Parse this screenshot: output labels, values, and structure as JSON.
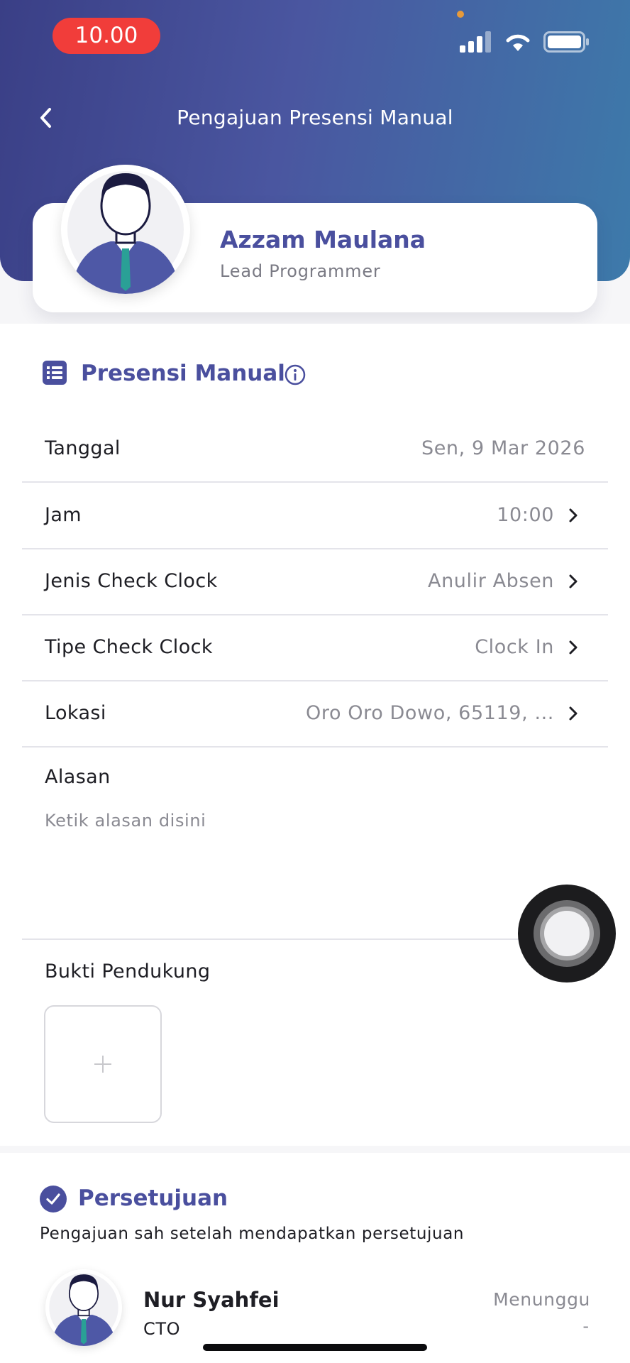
{
  "status_bar": {
    "time": "10.00"
  },
  "header": {
    "title": "Pengajuan Presensi Manual"
  },
  "profile": {
    "name": "Azzam Maulana",
    "role": "Lead Programmer"
  },
  "section": {
    "title": "Presensi Manual"
  },
  "form": {
    "rows": [
      {
        "label": "Tanggal",
        "value": "Sen, 9 Mar 2026",
        "chevron": false
      },
      {
        "label": "Jam",
        "value": "10:00",
        "chevron": true
      },
      {
        "label": "Jenis Check Clock",
        "value": "Anulir Absen",
        "chevron": true
      },
      {
        "label": "Tipe Check Clock",
        "value": "Clock In",
        "chevron": true
      },
      {
        "label": "Lokasi",
        "value": "Oro Oro Dowo, 65119, ...",
        "chevron": true
      }
    ],
    "reason": {
      "label": "Alasan",
      "placeholder": "Ketik alasan disini",
      "value": ""
    },
    "proof": {
      "label": "Bukti Pendukung"
    }
  },
  "approval": {
    "title": "Persetujuan",
    "subtitle": "Pengajuan sah setelah mendapatkan persetujuan",
    "approvers": [
      {
        "name": "Nur Syahfei",
        "role": "CTO",
        "status": "Menunggu",
        "date": "-"
      }
    ]
  },
  "colors": {
    "accent": "#4a4f9e",
    "header_start": "#3a3f86",
    "header_end": "#3d7aaa",
    "status_time_bg": "#f13d3a"
  },
  "icons": [
    "back-icon",
    "signal-icon",
    "wifi-icon",
    "battery-icon",
    "list-icon",
    "info-icon",
    "chevron-right-icon",
    "plus-icon",
    "check-circle-icon",
    "avatar-illustration"
  ]
}
